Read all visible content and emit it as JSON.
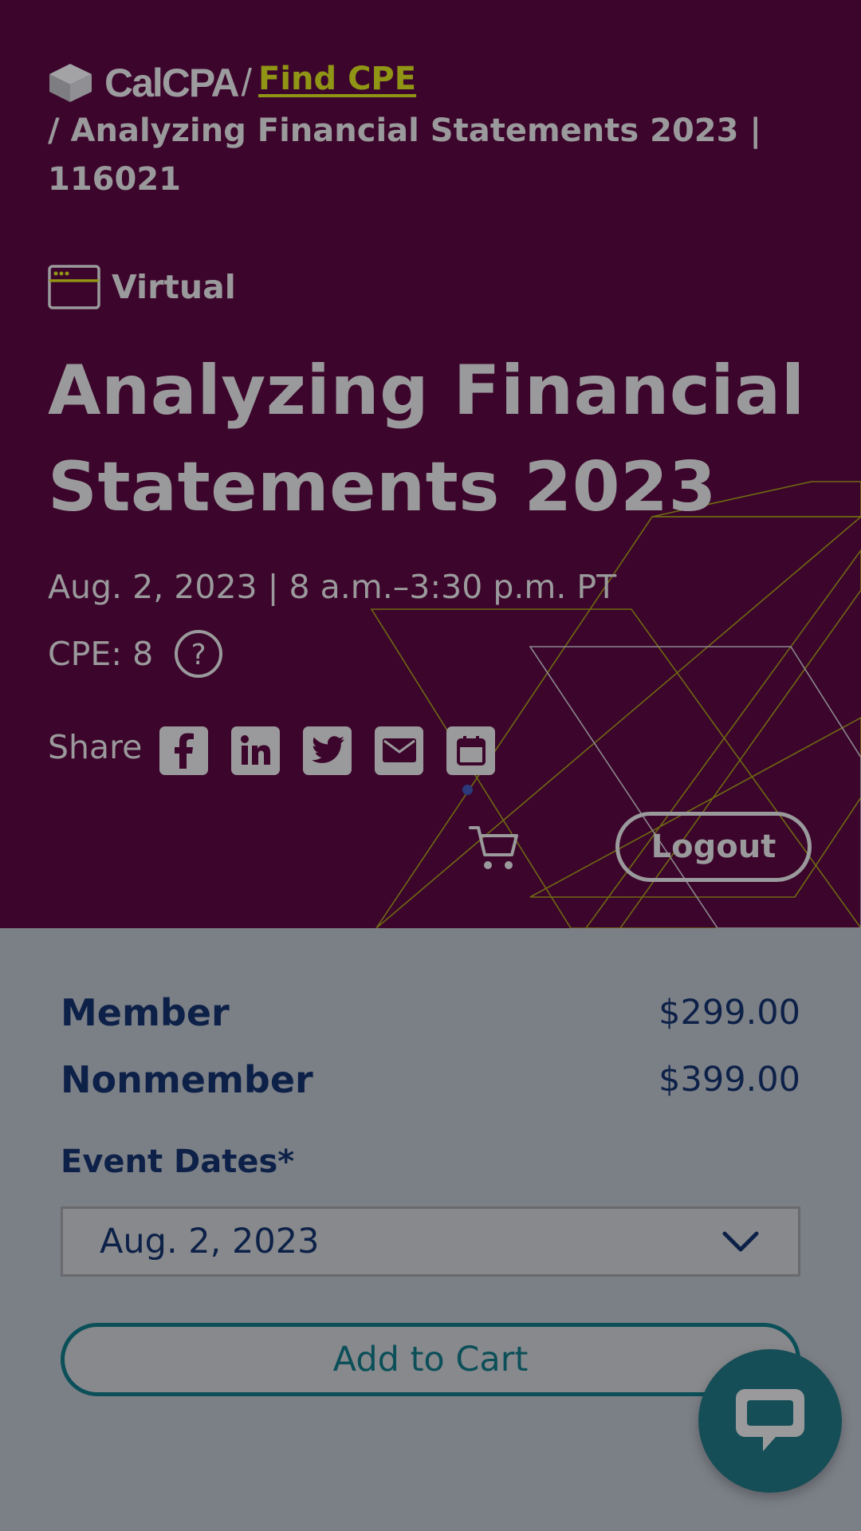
{
  "brand": {
    "name": "CalCPA"
  },
  "breadcrumb": {
    "separator": "/",
    "link_label": "Find CPE",
    "current": "/ Analyzing Financial Statements 2023 | 116021"
  },
  "event": {
    "format": "Virtual",
    "title": "Analyzing Financial Statements 2023",
    "date_time": "Aug. 2, 2023 | 8 a.m.–3:30 p.m. PT",
    "cpe_label": "CPE: 8"
  },
  "share": {
    "label": "Share",
    "icons": [
      "facebook-icon",
      "linkedin-icon",
      "twitter-icon",
      "email-icon",
      "calendar-icon"
    ]
  },
  "account": {
    "logout_label": "Logout"
  },
  "pricing": {
    "rows": [
      {
        "label": "Member",
        "price": "$299.00"
      },
      {
        "label": "Nonmember",
        "price": "$399.00"
      }
    ],
    "dates_label": "Event Dates*",
    "selected_date": "Aug. 2, 2023",
    "add_to_cart_label": "Add to Cart"
  },
  "colors": {
    "hero_bg": "#3c052b",
    "overlay_gray": "#7b7f86",
    "accent_olive": "#909515",
    "navy_text": "#0d2148",
    "teal": "#0b4f59"
  }
}
